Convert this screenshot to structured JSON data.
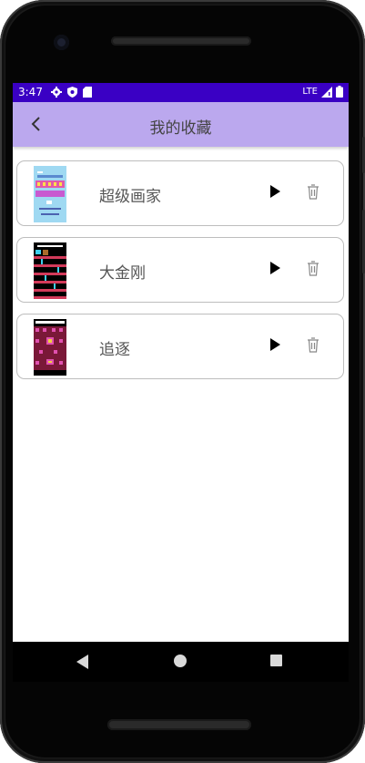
{
  "status_bar": {
    "time": "3:47",
    "network": "LTE",
    "icons": [
      "settings-icon",
      "shield-icon",
      "sd-card-icon",
      "signal-icon",
      "battery-icon"
    ],
    "color": "#3a00c4"
  },
  "app_bar": {
    "title": "我的收藏",
    "back_icon": "chevron-left-icon",
    "color": "#bba8ee"
  },
  "favorites": [
    {
      "name": "超级画家",
      "thumbnail": "super-painter-thumbnail",
      "play_icon": "play-icon",
      "delete_icon": "trash-icon"
    },
    {
      "name": "大金刚",
      "thumbnail": "donkey-kong-thumbnail",
      "play_icon": "play-icon",
      "delete_icon": "trash-icon"
    },
    {
      "name": "追逐",
      "thumbnail": "chase-game-thumbnail",
      "play_icon": "play-icon",
      "delete_icon": "trash-icon"
    }
  ],
  "nav_bar": {
    "back": "nav-back-icon",
    "home": "nav-home-icon",
    "recents": "nav-recents-icon"
  }
}
